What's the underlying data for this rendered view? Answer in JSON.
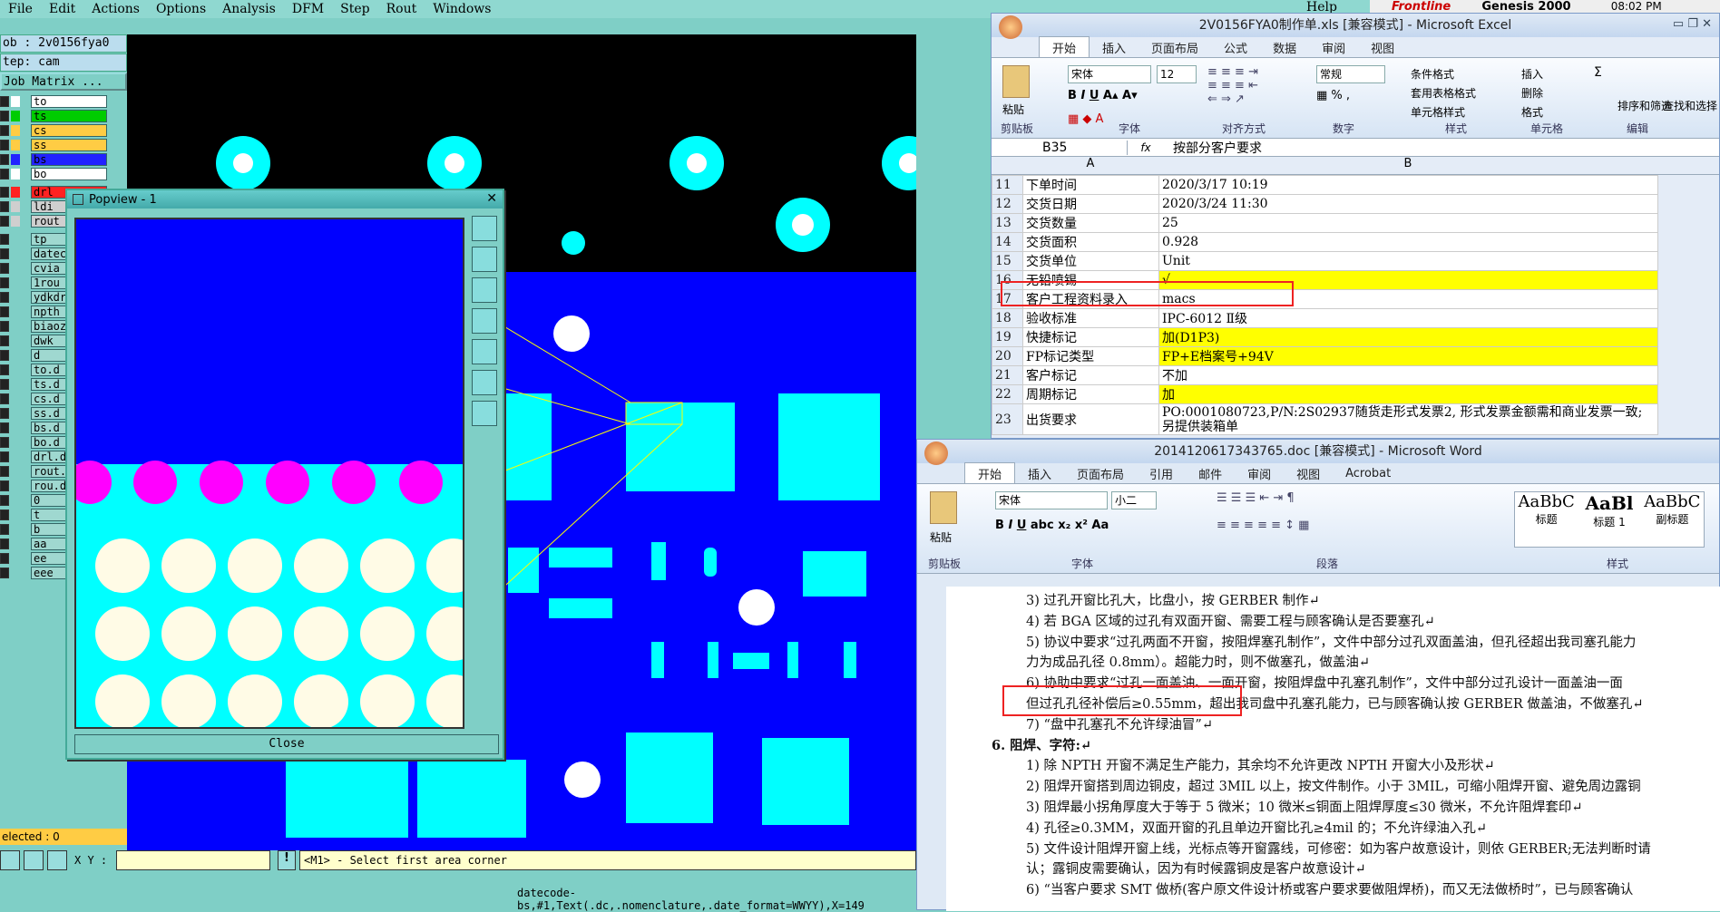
{
  "genesis": {
    "menu": [
      "File",
      "Edit",
      "Actions",
      "Options",
      "Analysis",
      "DFM",
      "Step",
      "Rout",
      "Windows"
    ],
    "help": "Help",
    "brand": "Frontline",
    "product": "Genesis 2000",
    "clock": "08:02 PM",
    "job": "ob : 2v0156fya0",
    "step": "tep: cam",
    "matrix_btn": "Job Matrix ...",
    "layers": [
      {
        "name": "to",
        "color": "#ffffff"
      },
      {
        "name": "ts",
        "color": "#00cc00"
      },
      {
        "name": "cs",
        "color": "#ffcc44"
      },
      {
        "name": "ss",
        "color": "#ffcc44"
      },
      {
        "name": "bs",
        "color": "#2222ff"
      },
      {
        "name": "bo",
        "color": "#ffffff"
      },
      {
        "name": "drl",
        "color": "#ff2222"
      },
      {
        "name": "ldi",
        "color": "#cfcfcf"
      },
      {
        "name": "rout",
        "color": "#cfcfcf"
      },
      {
        "name": "tp",
        "color": "#9fd8d0"
      },
      {
        "name": "datecod",
        "color": "#9fd8d0"
      },
      {
        "name": "cvia",
        "color": "#9fd8d0"
      },
      {
        "name": "1rou",
        "color": "#9fd8d0"
      },
      {
        "name": "ydkdrl",
        "color": "#9fd8d0"
      },
      {
        "name": "npth",
        "color": "#9fd8d0"
      },
      {
        "name": "biaozh",
        "color": "#9fd8d0"
      },
      {
        "name": "dwk",
        "color": "#9fd8d0"
      },
      {
        "name": "d",
        "color": "#9fd8d0"
      },
      {
        "name": "to.d",
        "color": "#9fd8d0"
      },
      {
        "name": "ts.d",
        "color": "#9fd8d0"
      },
      {
        "name": "cs.d",
        "color": "#9fd8d0"
      },
      {
        "name": "ss.d",
        "color": "#9fd8d0"
      },
      {
        "name": "bs.d",
        "color": "#9fd8d0"
      },
      {
        "name": "bo.d",
        "color": "#9fd8d0"
      },
      {
        "name": "drl.d",
        "color": "#9fd8d0"
      },
      {
        "name": "rout.d",
        "color": "#9fd8d0"
      },
      {
        "name": "rou.d",
        "color": "#9fd8d0"
      },
      {
        "name": "0",
        "color": "#9fd8d0"
      },
      {
        "name": "t",
        "color": "#9fd8d0"
      },
      {
        "name": "b",
        "color": "#9fd8d0"
      },
      {
        "name": "aa",
        "color": "#9fd8d0"
      },
      {
        "name": "ee",
        "color": "#9fd8d0"
      },
      {
        "name": "eee",
        "color": "#9fd8d0"
      }
    ],
    "selected": "elected : 0",
    "xy_label": "X Y :",
    "prompt": "<M1> - Select first area corner",
    "status": "datecode-bs,#1,Text(.dc,.nomenclature,.date_format=WWYY),X=149"
  },
  "popview": {
    "title": "Popview - 1",
    "close_btn": "Close"
  },
  "excel": {
    "title": "2V0156FYA0制作单.xls  [兼容模式] - Microsoft Excel",
    "tabs": [
      "开始",
      "插入",
      "页面布局",
      "公式",
      "数据",
      "审阅",
      "视图"
    ],
    "groups": [
      "剪贴板",
      "字体",
      "对齐方式",
      "数字",
      "样式",
      "单元格",
      "编辑"
    ],
    "font": "宋体",
    "size": "12",
    "numfmt": "常规",
    "paste": "粘贴",
    "style_items": [
      "条件格式",
      "套用表格格式",
      "单元格样式"
    ],
    "cell_items": [
      "插入",
      "删除",
      "格式"
    ],
    "edit_items": [
      "排序和筛选",
      "查找和选择"
    ],
    "namebox": "B35",
    "formula": "按部分客户要求",
    "fx": "fx",
    "col_a": "A",
    "col_b": "B",
    "rows": [
      {
        "n": "11",
        "a": "下单时间",
        "b": "2020/3/17 10:19",
        "y": false
      },
      {
        "n": "12",
        "a": "交货日期",
        "b": "2020/3/24 11:30",
        "y": false
      },
      {
        "n": "13",
        "a": "交货数量",
        "b": "25",
        "y": false
      },
      {
        "n": "14",
        "a": "交货面积",
        "b": "0.928",
        "y": false
      },
      {
        "n": "15",
        "a": "交货单位",
        "b": "Unit",
        "y": false
      },
      {
        "n": "16",
        "a": "无铅喷锡",
        "b": "√",
        "y": true
      },
      {
        "n": "17",
        "a": "客户工程资料录入",
        "b": "macs",
        "y": false
      },
      {
        "n": "18",
        "a": "验收标准",
        "b": "IPC-6012 Ⅱ级",
        "y": false
      },
      {
        "n": "19",
        "a": "快捷标记",
        "b": "加(D1P3)",
        "y": true
      },
      {
        "n": "20",
        "a": "FP标记类型",
        "b": "FP+E档案号+94V",
        "y": true
      },
      {
        "n": "21",
        "a": "客户标记",
        "b": "不加",
        "y": false
      },
      {
        "n": "22",
        "a": "周期标记",
        "b": "加",
        "y": true
      },
      {
        "n": "23",
        "a": "出货要求",
        "b": "PO:0001080723,P/N:2S02937随货走形式发票2, 形式发票金额需和商业发票一致;另提供装箱单",
        "y": false
      }
    ]
  },
  "word": {
    "title": "2014120617343765.doc [兼容模式] - Microsoft Word",
    "tabs": [
      "开始",
      "插入",
      "页面布局",
      "引用",
      "邮件",
      "审阅",
      "视图",
      "Acrobat"
    ],
    "groups": [
      "剪贴板",
      "字体",
      "段落",
      "样式"
    ],
    "font": "宋体",
    "size": "小二",
    "paste": "粘贴",
    "styles": [
      {
        "preview": "AaBbC",
        "name": "标题"
      },
      {
        "preview": "AaBl",
        "name": "标题 1"
      },
      {
        "preview": "AaBbC",
        "name": "副标题"
      }
    ],
    "lines": [
      "3)   过孔开窗比孔大，比盘小，按 GERBER 制作↵",
      "4)   若 BGA 区域的过孔有双面开窗、需要工程与顾客确认是否要塞孔↵",
      "5)   协议中要求“过孔两面不开窗，按阻焊塞孔制作”，文件中部分过孔双面盖油，但孔径超出我司塞孔能力",
      "      力为成品孔径 0.8mm）。超能力时，则不做塞孔，做盖油↵",
      "6)   协助中要求“过孔一面盖油、一面开窗，按阻焊盘中孔塞孔制作”，文件中部分过孔设计一面盖油一面",
      "      但过孔孔径补偿后≥0.55mm，超出我司盘中孔塞孔能力，已与顾客确认按 GERBER 做盖油，不做塞孔↵",
      "7)   “盘中孔塞孔不允许绿油冒”↵",
      "6.   阻焊、字符:↵",
      "1)   除 NPTH 开窗不满足生产能力，其余均不允许更改 NPTH 开窗大小及形状↵",
      "2)   阻焊开窗搭到周边铜皮，超过 3MIL 以上，按文件制作。小于 3MIL，可缩小阻焊开窗、避免周边露铜",
      "3)   阻焊最小拐角厚度大于等于 5 微米；10 微米≤铜面上阻焊厚度≤30 微米，不允许阻焊套印↵",
      "4)   孔径≥0.3MM，双面开窗的孔且单边开窗比孔≥4mil 的；不允许绿油入孔↵",
      "5)   文件设计阻焊开窗上线，光标点等开窗露线，可修密：如为客户故意设计，则依 GERBER;无法判断时请",
      "      认；露铜皮需要确认，因为有时候露铜皮是客户故意设计↵",
      "6)   “当客户要求 SMT 做桥(客户原文件设计桥或客户要求要做阻焊桥)，而又无法做桥时”，已与顾客确认"
    ]
  }
}
